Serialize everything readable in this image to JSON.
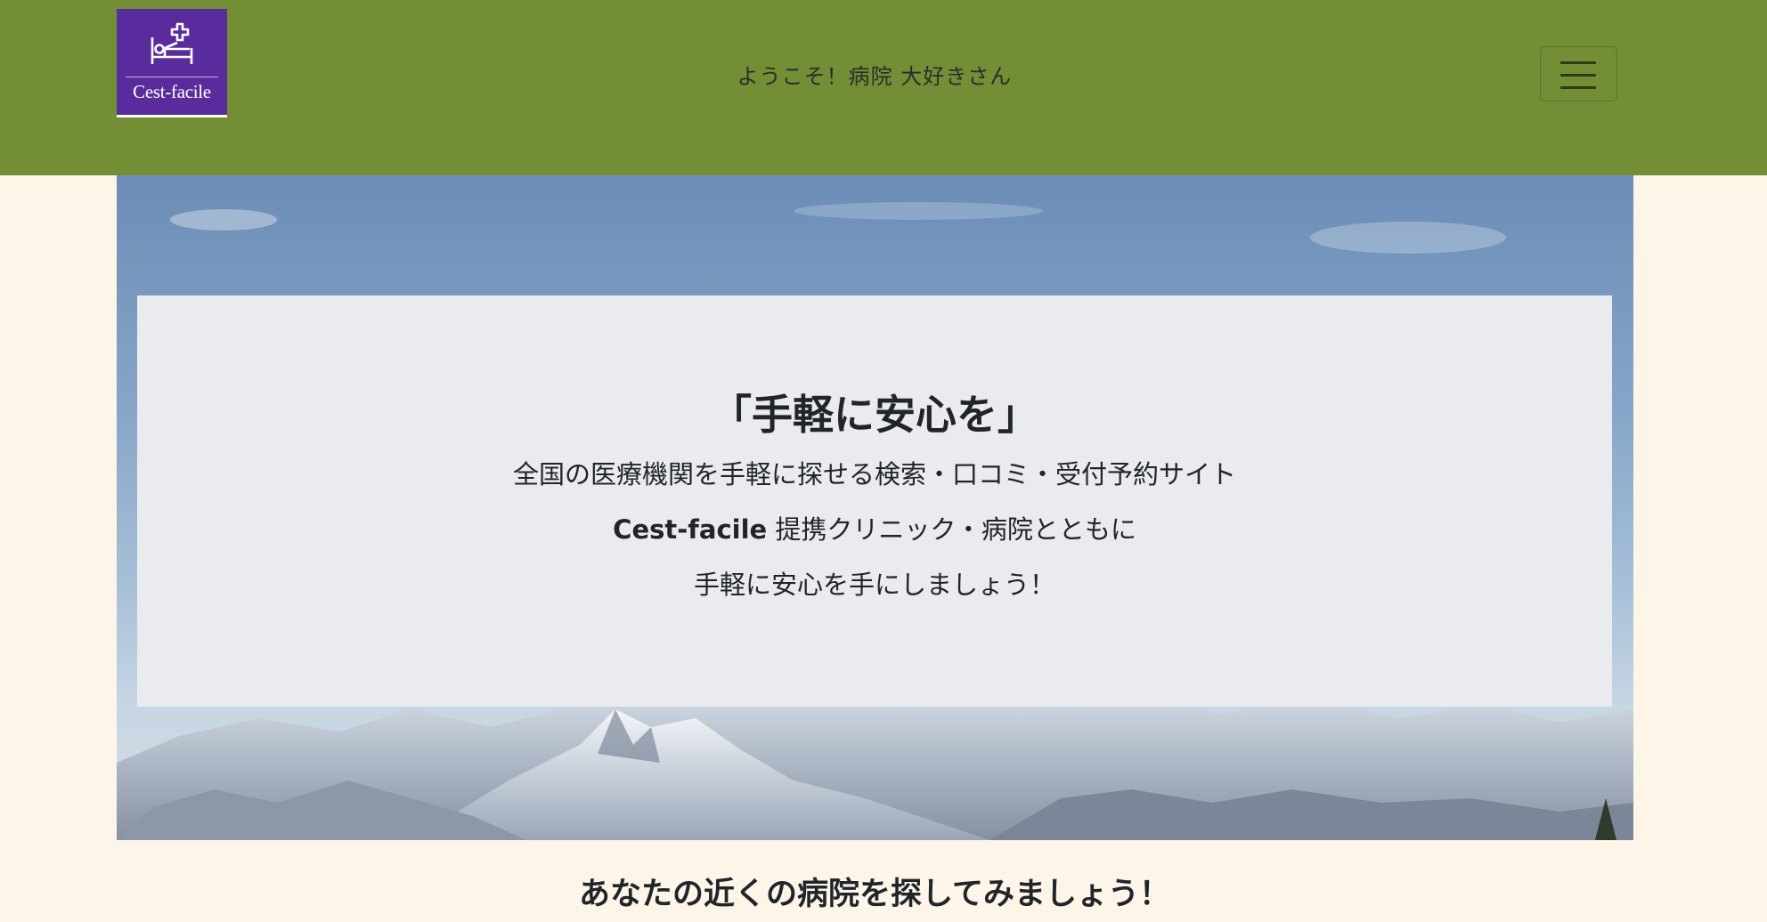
{
  "header": {
    "logo": {
      "icon": "hospital-bed-cross-icon",
      "text": "Cest-facile",
      "background": "#5a2b9c"
    },
    "welcome_text": "ようこそ！病院 大好きさん",
    "menu_icon": "hamburger-menu-icon",
    "background": "#748e35"
  },
  "hero": {
    "background_image": "snowy-mountains-under-blue-sky",
    "title": "「手軽に安心を」",
    "line1": "全国の医療機関を手軽に探せる検索・口コミ・受付予約サイト",
    "line2_brand": "Cest-facile",
    "line2_rest": " 提携クリニック・病院とともに",
    "line3": "手軽に安心を手にしましょう！"
  },
  "section": {
    "title": "あなたの近くの病院を探してみましょう！"
  },
  "colors": {
    "page_background": "#fdf5e8",
    "card_background": "#e9ebee"
  }
}
